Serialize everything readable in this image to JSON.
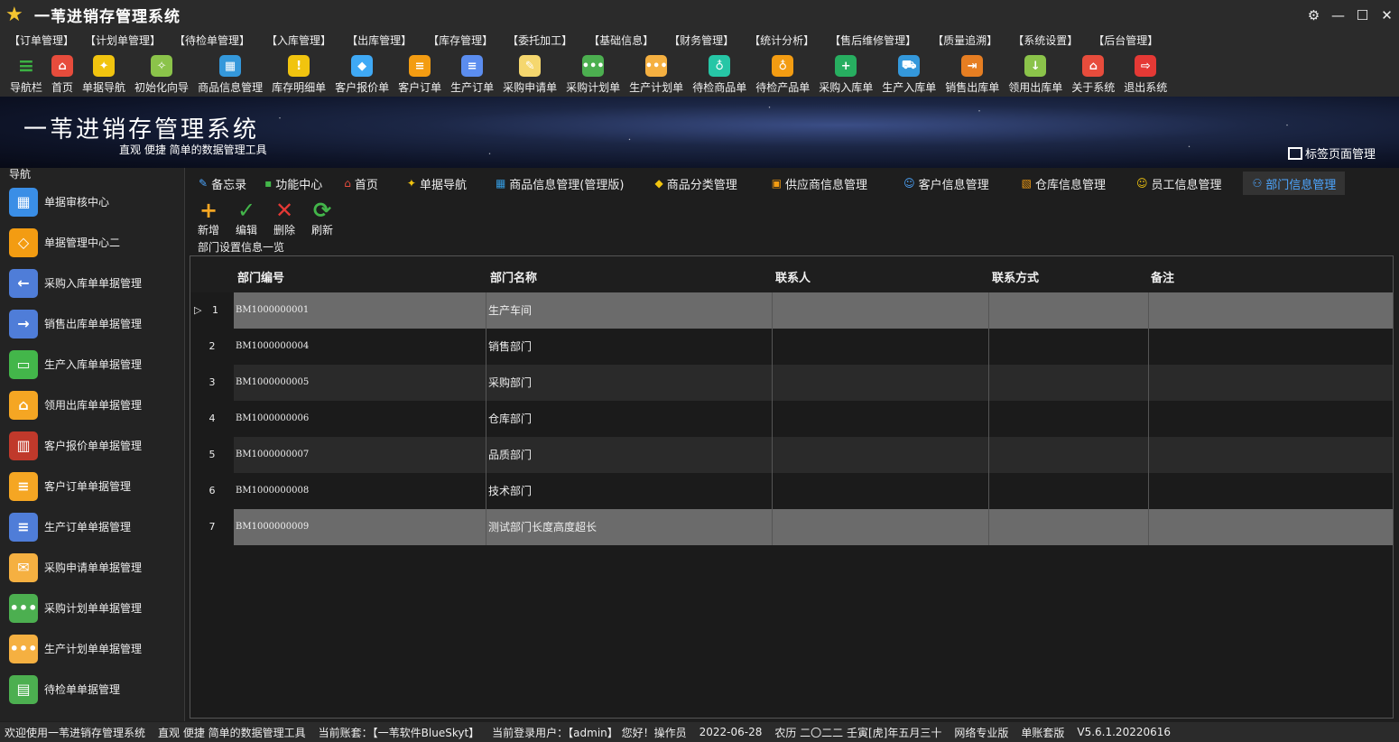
{
  "window": {
    "title": "一苇进销存管理系统"
  },
  "menu": [
    "【订单管理】",
    "【计划单管理】",
    "【待检单管理】",
    "【入库管理】",
    "【出库管理】",
    "【库存管理】",
    "【委托加工】",
    "【基础信息】",
    "【财务管理】",
    "【统计分析】",
    "【售后维修管理】",
    "【质量追溯】",
    "【系统设置】",
    "【后台管理】"
  ],
  "toolbar": [
    {
      "label": "导航栏",
      "icon": "hamburger-icon",
      "color": "#3cb043",
      "glyph": "≡"
    },
    {
      "label": "首页",
      "icon": "home-icon",
      "color": "#e74c3c",
      "glyph": "⌂"
    },
    {
      "label": "单据导航",
      "icon": "lamp-icon",
      "color": "#f1c40f",
      "glyph": "✦"
    },
    {
      "label": "初始化向导",
      "icon": "wand-icon",
      "color": "#8bc34a",
      "glyph": "✧"
    },
    {
      "label": "商品信息管理",
      "icon": "cubes-icon",
      "color": "#3498db",
      "glyph": "▦"
    },
    {
      "label": "库存明细单",
      "icon": "warning-icon",
      "color": "#f1c40f",
      "glyph": "!"
    },
    {
      "label": "客户报价单",
      "icon": "tag-icon",
      "color": "#3fa9f5",
      "glyph": "◆"
    },
    {
      "label": "客户订单",
      "icon": "order-icon",
      "color": "#f39c12",
      "glyph": "≡"
    },
    {
      "label": "生产订单",
      "icon": "document-icon",
      "color": "#5b8def",
      "glyph": "≡"
    },
    {
      "label": "采购申请单",
      "icon": "note-icon",
      "color": "#f5d76e",
      "glyph": "✎"
    },
    {
      "label": "采购计划单",
      "icon": "chat-icon",
      "color": "#4caf50",
      "glyph": "•••"
    },
    {
      "label": "生产计划单",
      "icon": "chat-icon",
      "color": "#f5b041",
      "glyph": "•••"
    },
    {
      "label": "待检商品单",
      "icon": "flask-icon",
      "color": "#26c6a6",
      "glyph": "♁"
    },
    {
      "label": "待检产品单",
      "icon": "flask-icon",
      "color": "#f39c12",
      "glyph": "♁"
    },
    {
      "label": "采购入库单",
      "icon": "plus-icon",
      "color": "#27ae60",
      "glyph": "+"
    },
    {
      "label": "生产入库单",
      "icon": "cart-icon",
      "color": "#3498db",
      "glyph": "⛟"
    },
    {
      "label": "销售出库单",
      "icon": "outbox-icon",
      "color": "#e67e22",
      "glyph": "⇥"
    },
    {
      "label": "领用出库单",
      "icon": "download-icon",
      "color": "#8bc34a",
      "glyph": "↓"
    },
    {
      "label": "关于系统",
      "icon": "house-icon",
      "color": "#e74c3c",
      "glyph": "⌂"
    },
    {
      "label": "退出系统",
      "icon": "exit-icon",
      "color": "#e53935",
      "glyph": "⇨"
    }
  ],
  "banner": {
    "title": "一苇进销存管理系统",
    "subtitle": "直观 便捷 简单的数据管理工具",
    "tag_manage": "标签页面管理"
  },
  "sidebar": {
    "header": "导航",
    "items": [
      {
        "label": "单据审核中心",
        "color": "#3a8ee6",
        "glyph": "▦"
      },
      {
        "label": "单据管理中心二",
        "color": "#f39c12",
        "glyph": "◇"
      },
      {
        "label": "采购入库单单据管理",
        "color": "#4f7dd8",
        "glyph": "←"
      },
      {
        "label": "销售出库单单据管理",
        "color": "#4f7dd8",
        "glyph": "→"
      },
      {
        "label": "生产入库单单据管理",
        "color": "#43b64a",
        "glyph": "▭"
      },
      {
        "label": "领用出库单单据管理",
        "color": "#f5a623",
        "glyph": "⌂"
      },
      {
        "label": "客户报价单单据管理",
        "color": "#c0392b",
        "glyph": "▥"
      },
      {
        "label": "客户订单单据管理",
        "color": "#f5a623",
        "glyph": "≡"
      },
      {
        "label": "生产订单单据管理",
        "color": "#4f7dd8",
        "glyph": "≡"
      },
      {
        "label": "采购申请单单据管理",
        "color": "#f5b041",
        "glyph": "✉"
      },
      {
        "label": "采购计划单单据管理",
        "color": "#4caf50",
        "glyph": "•••"
      },
      {
        "label": "生产计划单单据管理",
        "color": "#f5b041",
        "glyph": "•••"
      },
      {
        "label": "待检单单据管理",
        "color": "#4caf50",
        "glyph": "▤"
      }
    ]
  },
  "tabs": [
    {
      "label": "备忘录",
      "icon": "memo-icon",
      "glyph": "✎",
      "color": "#4da6ff"
    },
    {
      "label": "功能中心",
      "icon": "grid-icon",
      "glyph": "▪",
      "color": "#43b64a"
    },
    {
      "label": "首页",
      "icon": "home-icon",
      "glyph": "⌂",
      "color": "#e74c3c"
    },
    {
      "label": "单据导航",
      "icon": "lamp-icon",
      "glyph": "✦",
      "color": "#f1c40f"
    },
    {
      "label": "商品信息管理(管理版)",
      "icon": "cubes-icon",
      "glyph": "▦",
      "color": "#3498db"
    },
    {
      "label": "商品分类管理",
      "icon": "tag-icon",
      "glyph": "◆",
      "color": "#f1c40f"
    },
    {
      "label": "供应商信息管理",
      "icon": "supplier-icon",
      "glyph": "▣",
      "color": "#f39c12"
    },
    {
      "label": "客户信息管理",
      "icon": "user-icon",
      "glyph": "☺",
      "color": "#4da6ff"
    },
    {
      "label": "仓库信息管理",
      "icon": "box-icon",
      "glyph": "▧",
      "color": "#f39c12"
    },
    {
      "label": "员工信息管理",
      "icon": "staff-icon",
      "glyph": "☺",
      "color": "#f1c40f"
    },
    {
      "label": "部门信息管理",
      "icon": "department-icon",
      "glyph": "⚇",
      "color": "#4da6ff",
      "active": true
    }
  ],
  "actions": [
    {
      "label": "新增",
      "icon": "add-icon",
      "glyph": "+",
      "color": "#f5a623"
    },
    {
      "label": "编辑",
      "icon": "check-icon",
      "glyph": "✓",
      "color": "#43b64a"
    },
    {
      "label": "删除",
      "icon": "delete-icon",
      "glyph": "✕",
      "color": "#e53935"
    },
    {
      "label": "刷新",
      "icon": "refresh-icon",
      "glyph": "⟳",
      "color": "#43b64a"
    }
  ],
  "section_title": "部门设置信息一览",
  "table": {
    "columns": [
      "部门编号",
      "部门名称",
      "联系人",
      "联系方式",
      "备注"
    ],
    "rows": [
      {
        "idx": "1",
        "code": "BM1000000001",
        "name": "生产车间",
        "contact": "",
        "phone": "",
        "note": ""
      },
      {
        "idx": "2",
        "code": "BM1000000004",
        "name": "销售部门",
        "contact": "",
        "phone": "",
        "note": ""
      },
      {
        "idx": "3",
        "code": "BM1000000005",
        "name": "采购部门",
        "contact": "",
        "phone": "",
        "note": ""
      },
      {
        "idx": "4",
        "code": "BM1000000006",
        "name": "仓库部门",
        "contact": "",
        "phone": "",
        "note": ""
      },
      {
        "idx": "5",
        "code": "BM1000000007",
        "name": "品质部门",
        "contact": "",
        "phone": "",
        "note": ""
      },
      {
        "idx": "6",
        "code": "BM1000000008",
        "name": "技术部门",
        "contact": "",
        "phone": "",
        "note": ""
      },
      {
        "idx": "7",
        "code": "BM1000000009",
        "name": "测试部门长度高度超长",
        "contact": "",
        "phone": "",
        "note": ""
      }
    ]
  },
  "status": [
    "欢迎使用一苇进销存管理系统",
    "直观 便捷 简单的数据管理工具",
    "当前账套：【一苇软件BlueSkyt】",
    "当前登录用户：【admin】 您好！操作员",
    "2022-06-28",
    "农历 二〇二二 壬寅[虎]年五月三十",
    "网络专业版",
    "单账套版",
    "V5.6.1.20220616"
  ]
}
